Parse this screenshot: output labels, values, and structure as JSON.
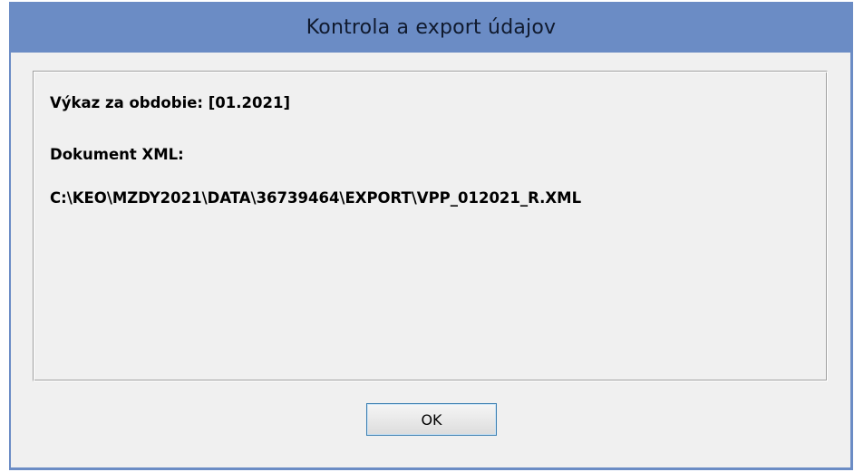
{
  "dialog": {
    "title": "Kontrola a export údajov",
    "period_line": "Výkaz za obdobie: [01.2021]",
    "xml_label": "Dokument XML:",
    "xml_path": "C:\\KEO\\MZDY2021\\DATA\\36739464\\EXPORT\\VPP_012021_R.XML",
    "ok_label": "OK"
  },
  "colors": {
    "title_bar": "#6b8cc5",
    "client_background": "#f0f0f0",
    "button_border": "#3c7fb1"
  }
}
